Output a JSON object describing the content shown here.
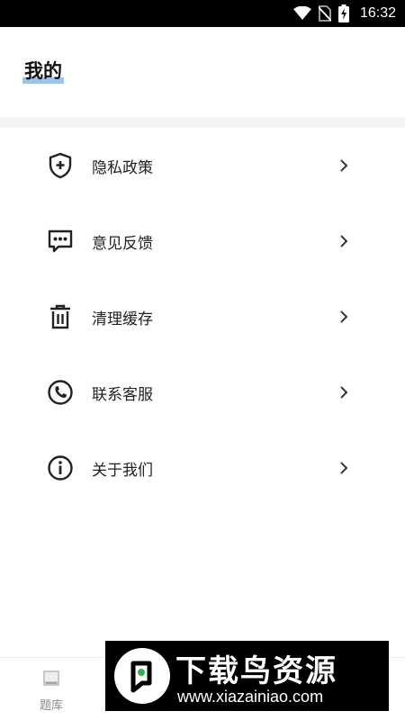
{
  "status_bar": {
    "time": "16:32",
    "icons": [
      "wifi-icon",
      "no-sim-icon",
      "battery-charging-icon"
    ]
  },
  "header": {
    "title": "我的"
  },
  "menu": {
    "items": [
      {
        "label": "隐私政策",
        "icon": "shield-plus-icon"
      },
      {
        "label": "意见反馈",
        "icon": "message-dots-icon"
      },
      {
        "label": "清理缓存",
        "icon": "trash-icon"
      },
      {
        "label": "联系客服",
        "icon": "phone-icon"
      },
      {
        "label": "关于我们",
        "icon": "info-icon"
      }
    ]
  },
  "bottom_nav": {
    "tabs": [
      {
        "label": "题库",
        "icon": "question-bank-icon"
      }
    ]
  },
  "watermark": {
    "title": "下载鸟资源",
    "url": "www.xiazainiao.com"
  },
  "colors": {
    "title_highlight": "#9cc3ee",
    "separator": "#f4f4f4",
    "text": "#222222",
    "watermark_bg": "#000000",
    "watermark_accent": "#2db34a"
  }
}
